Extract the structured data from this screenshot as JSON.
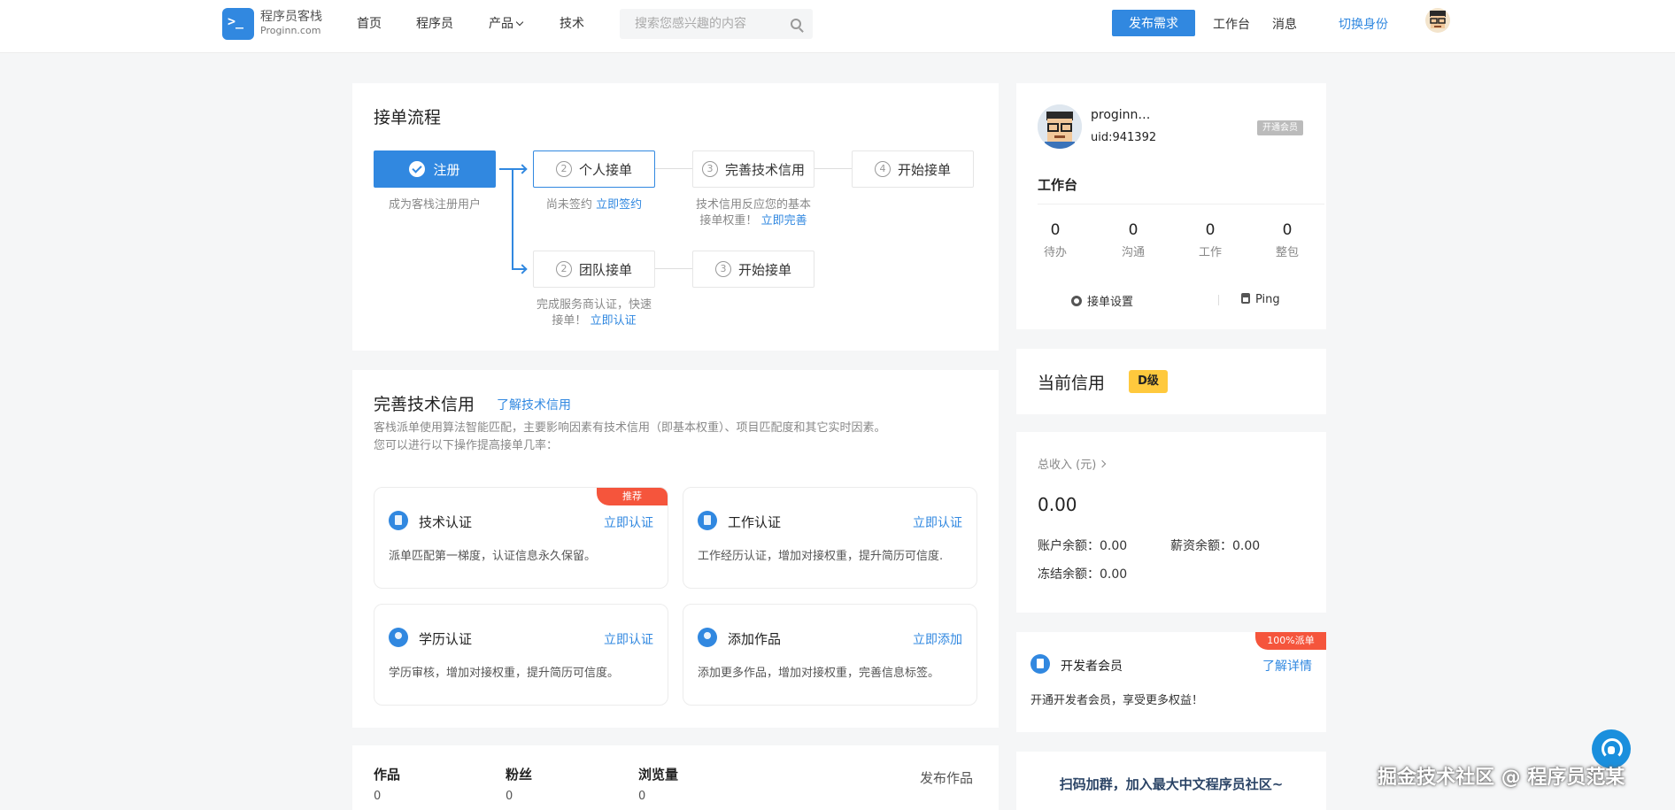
{
  "header": {
    "logo_title": "程序员客栈",
    "logo_sub": "Proginn.com",
    "nav": [
      "首页",
      "程序员",
      "产品",
      "技术"
    ],
    "search_placeholder": "搜索您感兴趣的内容",
    "publish_btn": "发布需求",
    "links": [
      "工作台",
      "消息"
    ],
    "switch_identity": "切换身份"
  },
  "flow": {
    "title": "接单流程",
    "steps": {
      "register": "注册",
      "personal": "个人接单",
      "tech_credit": "完善技术信用",
      "start1": "开始接单",
      "team": "团队接单",
      "start2": "开始接单"
    },
    "step_numbers": {
      "personal": "2",
      "tech_credit": "3",
      "start1": "4",
      "team": "2",
      "start2": "3"
    },
    "register_desc": "成为客栈注册用户",
    "personal_desc": "尚未签约",
    "personal_link": "立即签约",
    "credit_desc_1": "技术信用反应您的基本",
    "credit_desc_2": "接单权重！",
    "credit_link": "立即完善",
    "team_desc_1": "完成服务商认证，快速",
    "team_desc_2": "接单！",
    "team_link": "立即认证"
  },
  "credit_section": {
    "title": "完善技术信用",
    "learn_link": "了解技术信用",
    "desc_1": "客栈派单使用算法智能匹配，主要影响因素有技术信用（即基本权重）、项目匹配度和其它实时因素。",
    "desc_2": "您可以进行以下操作提高接单几率：",
    "cards": [
      {
        "title": "技术认证",
        "link": "立即认证",
        "desc": "派单匹配第一梯度，认证信息永久保留。",
        "ribbon": "推荐"
      },
      {
        "title": "工作认证",
        "link": "立即认证",
        "desc": "工作经历认证，增加对接权重，提升简历可信度."
      },
      {
        "title": "学历认证",
        "link": "立即认证",
        "desc": "学历审核，增加对接权重，提升简历可信度。"
      },
      {
        "title": "添加作品",
        "link": "立即添加",
        "desc": "添加更多作品，增加对接权重，完善信息标签。"
      }
    ]
  },
  "works": {
    "items": [
      {
        "label": "作品",
        "value": "0"
      },
      {
        "label": "粉丝",
        "value": "0"
      },
      {
        "label": "浏览量",
        "value": "0"
      }
    ],
    "publish_link": "发布作品"
  },
  "profile": {
    "username": "proginn…",
    "uid": "uid:941392",
    "vip_tag": "开通会员",
    "workbench_title": "工作台",
    "stats": [
      {
        "value": "0",
        "label": "待办"
      },
      {
        "value": "0",
        "label": "沟通"
      },
      {
        "value": "0",
        "label": "工作"
      },
      {
        "value": "0",
        "label": "整包"
      }
    ],
    "settings": "接单设置",
    "ping": "Ping"
  },
  "credit": {
    "title": "当前信用",
    "level": "D级"
  },
  "income": {
    "label": "总收入 (元)",
    "total": "0.00",
    "balance_label": "账户余额：",
    "balance": "0.00",
    "salary_label": "薪资余额：",
    "salary": "0.00",
    "frozen_label": "冻结余额：",
    "frozen": "0.00"
  },
  "member": {
    "ribbon": "100%派单",
    "title": "开发者会员",
    "link": "了解详情",
    "desc": "开通开发者会员，享受更多权益！"
  },
  "qr": {
    "text": "扫码加群，加入最大中文程序员社区~"
  },
  "watermark": "掘金技术社区 @ 程序员范某"
}
